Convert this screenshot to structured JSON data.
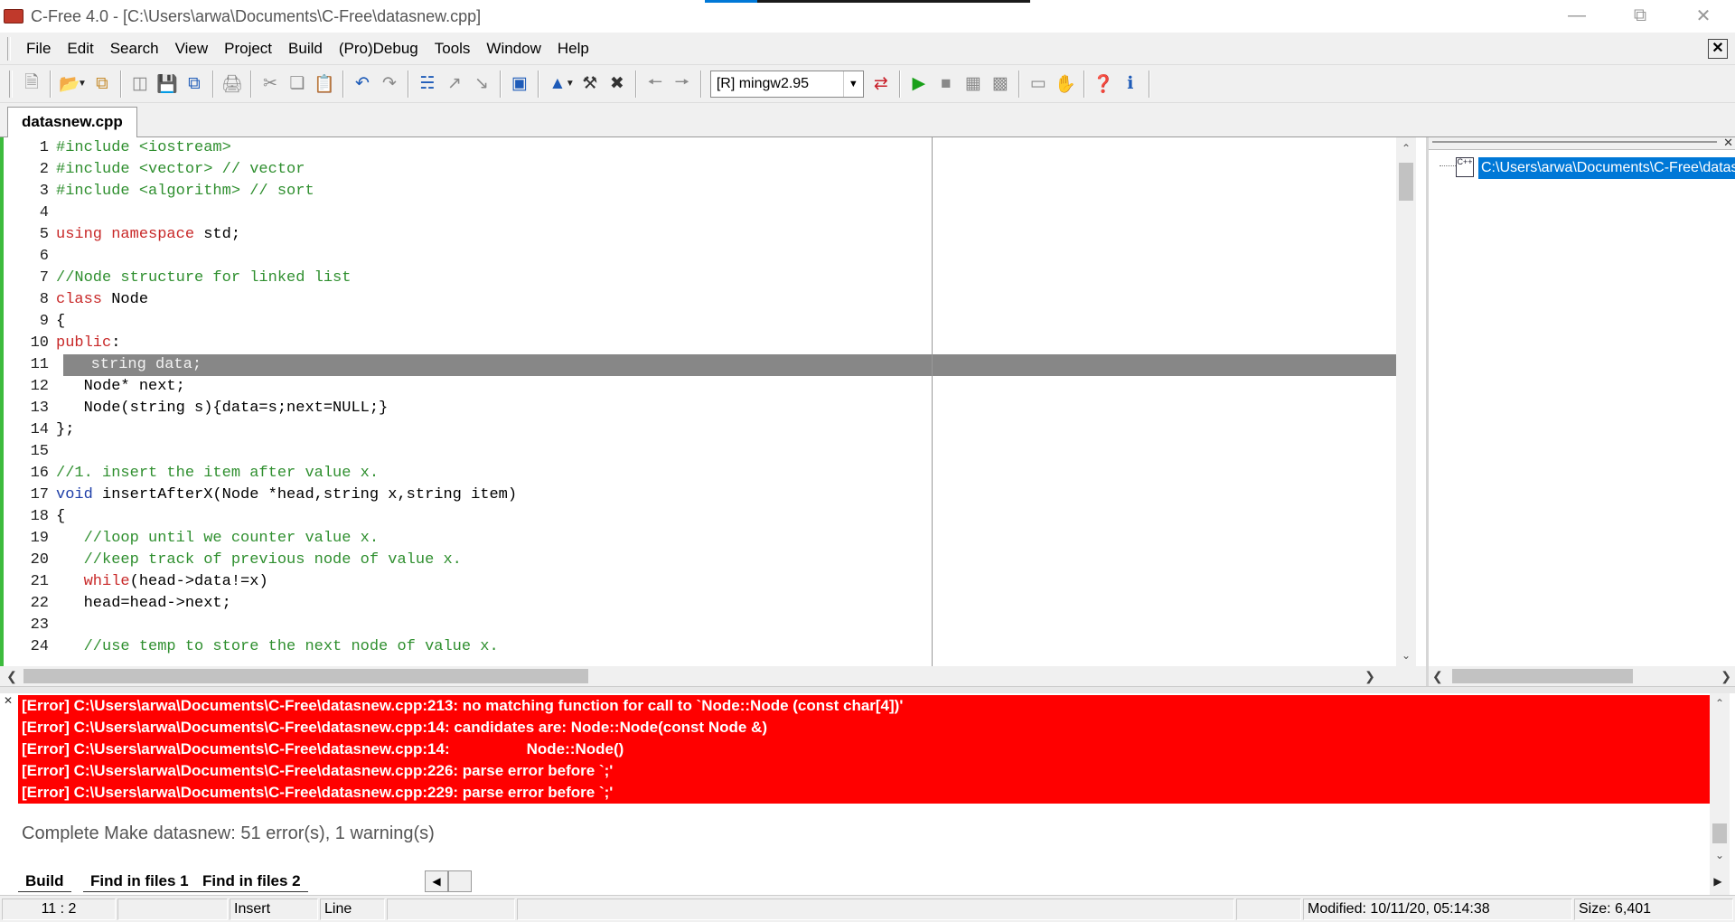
{
  "window": {
    "title": "C-Free 4.0 - [C:\\Users\\arwa\\Documents\\C-Free\\datasnew.cpp]",
    "progress_fraction": 0.16
  },
  "menu": [
    "File",
    "Edit",
    "Search",
    "View",
    "Project",
    "Build",
    "(Pro)Debug",
    "Tools",
    "Window",
    "Help"
  ],
  "toolbar": {
    "compiler_selected": "[R] mingw2.95"
  },
  "editor": {
    "tab_label": "datasnew.cpp",
    "highlight_line": 11,
    "lines": [
      {
        "n": "1",
        "segs": [
          {
            "t": "#include <iostream>",
            "c": "pp"
          }
        ]
      },
      {
        "n": "2",
        "segs": [
          {
            "t": "#include <vector> // vector",
            "c": "pp"
          }
        ]
      },
      {
        "n": "3",
        "segs": [
          {
            "t": "#include <algorithm> // sort",
            "c": "pp"
          }
        ]
      },
      {
        "n": "4",
        "segs": []
      },
      {
        "n": "5",
        "segs": [
          {
            "t": "using namespace",
            "c": "k"
          },
          {
            "t": " std;",
            "c": ""
          }
        ]
      },
      {
        "n": "6",
        "segs": []
      },
      {
        "n": "7",
        "segs": [
          {
            "t": "//Node structure for linked list",
            "c": "c"
          }
        ]
      },
      {
        "n": "8",
        "segs": [
          {
            "t": "class",
            "c": "k"
          },
          {
            "t": " Node",
            "c": ""
          }
        ]
      },
      {
        "n": "9",
        "segs": [
          {
            "t": "{",
            "c": ""
          }
        ]
      },
      {
        "n": "10",
        "segs": [
          {
            "t": "public",
            "c": "k"
          },
          {
            "t": ":",
            "c": ""
          }
        ]
      },
      {
        "n": "11",
        "segs": [
          {
            "t": "   string data;",
            "c": ""
          }
        ]
      },
      {
        "n": "12",
        "segs": [
          {
            "t": "   Node* next;",
            "c": ""
          }
        ]
      },
      {
        "n": "13",
        "segs": [
          {
            "t": "   Node(string s){data=s;next=NULL;}",
            "c": ""
          }
        ]
      },
      {
        "n": "14",
        "segs": [
          {
            "t": "};",
            "c": ""
          }
        ]
      },
      {
        "n": "15",
        "segs": []
      },
      {
        "n": "16",
        "segs": [
          {
            "t": "//1. insert the item after value x.",
            "c": "c"
          }
        ]
      },
      {
        "n": "17",
        "segs": [
          {
            "t": "void",
            "c": "kb"
          },
          {
            "t": " insertAfterX(Node *head,string x,string item)",
            "c": ""
          }
        ]
      },
      {
        "n": "18",
        "segs": [
          {
            "t": "{",
            "c": ""
          }
        ]
      },
      {
        "n": "19",
        "segs": [
          {
            "t": "   //loop until we counter value x.",
            "c": "c"
          }
        ]
      },
      {
        "n": "20",
        "segs": [
          {
            "t": "   //keep track of previous node of value x.",
            "c": "c"
          }
        ]
      },
      {
        "n": "21",
        "segs": [
          {
            "t": "   ",
            "c": ""
          },
          {
            "t": "while",
            "c": "k"
          },
          {
            "t": "(head->data!=x)",
            "c": ""
          }
        ]
      },
      {
        "n": "22",
        "segs": [
          {
            "t": "   head=head->next;",
            "c": ""
          }
        ]
      },
      {
        "n": "23",
        "segs": []
      },
      {
        "n": "24",
        "segs": [
          {
            "t": "   //use temp to store the next node of value x.",
            "c": "c"
          }
        ]
      }
    ]
  },
  "project_panel": {
    "item": "C:\\Users\\arwa\\Documents\\C-Free\\datasnew.cpp"
  },
  "output": {
    "errors": [
      "[Error] C:\\Users\\arwa\\Documents\\C-Free\\datasnew.cpp:213: no matching function for call to `Node::Node (const char[4])'",
      "[Error] C:\\Users\\arwa\\Documents\\C-Free\\datasnew.cpp:14: candidates are: Node::Node(const Node &)",
      "[Error] C:\\Users\\arwa\\Documents\\C-Free\\datasnew.cpp:14:                  Node::Node()",
      "[Error] C:\\Users\\arwa\\Documents\\C-Free\\datasnew.cpp:226: parse error before `;'",
      "[Error] C:\\Users\\arwa\\Documents\\C-Free\\datasnew.cpp:229: parse error before `;'"
    ],
    "summary": "Complete Make datasnew: 51 error(s), 1 warning(s)",
    "tabs": [
      "Build",
      "Find in files 1",
      "Find in files 2"
    ]
  },
  "status": {
    "position": "11 : 2",
    "mode": "Insert",
    "line_mode": "Line",
    "modified": "Modified: 10/11/20, 05:14:38",
    "size": "Size: 6,401"
  },
  "colors": {
    "error_bg": "#ff0000",
    "selection": "#0078d7",
    "current_line": "#878787",
    "keyword": "#c82828",
    "comment": "#2f8f2f"
  }
}
